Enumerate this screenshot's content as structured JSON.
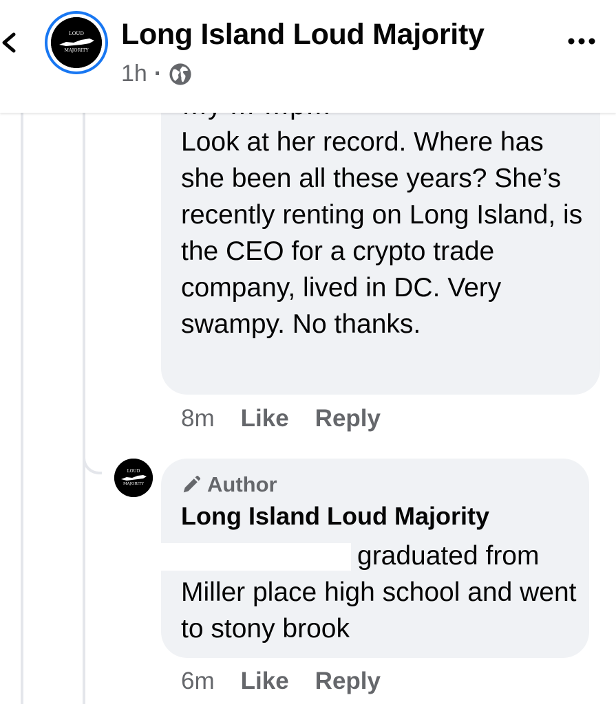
{
  "header": {
    "title": "Long Island Loud Majority",
    "time": "1h",
    "separator": "·",
    "privacy_icon": "globe-icon",
    "back_icon": "chevron-left-icon",
    "more_icon": "more-dots-icon",
    "avatar": {
      "logo_top": "LOUD",
      "logo_bottom": "MAJORITY"
    },
    "avatar_ring_color": "#1877f2"
  },
  "comments": [
    {
      "cutoff_line": "…y … …p…",
      "text": "Look at her record. Where has she been all these years? She’s recently renting on Long Island, is the CEO for a crypto trade company, lived in DC. Very swampy. No thanks.",
      "time": "8m",
      "like_label": "Like",
      "reply_label": "Reply"
    },
    {
      "badge": "Author",
      "badge_icon": "pencil-icon",
      "author": "Long Island Loud Majority",
      "avatar": {
        "logo_top": "LOUD",
        "logo_bottom": "MAJORITY"
      },
      "text": "graduated from Miller place high school and went to stony brook",
      "time": "6m",
      "like_label": "Like",
      "reply_label": "Reply"
    }
  ],
  "colors": {
    "bubble": "#f0f2f5",
    "secondary_text": "#65676b",
    "primary_text": "#050505",
    "accent": "#1877f2"
  }
}
